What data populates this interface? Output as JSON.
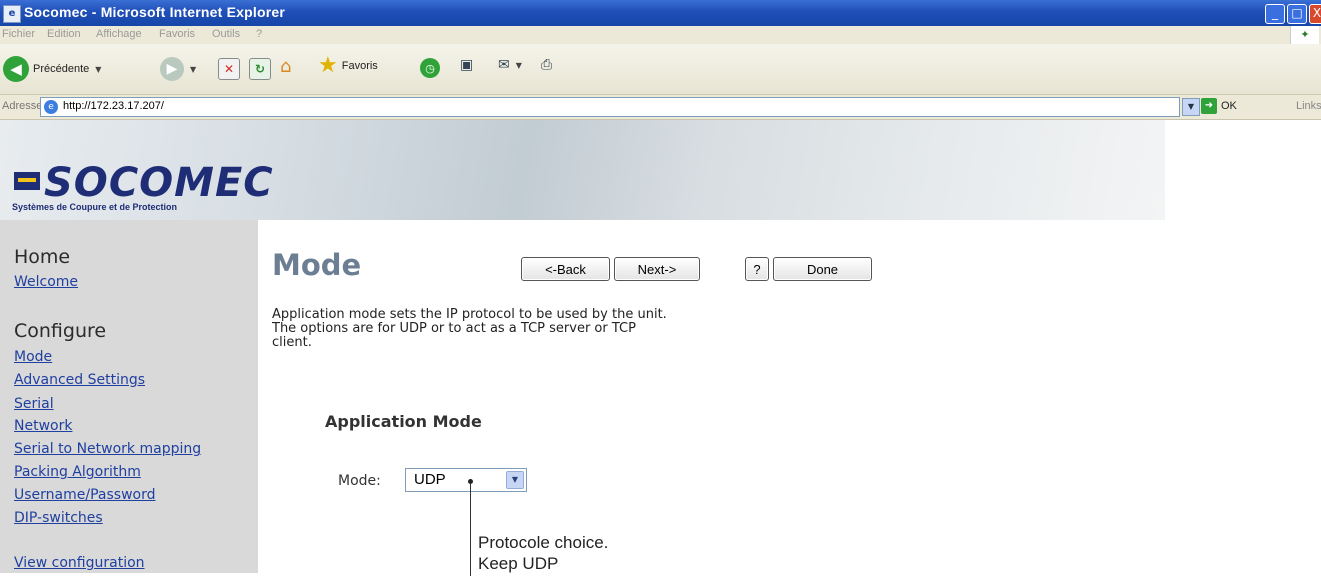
{
  "window": {
    "title": "Socomec - Microsoft Internet Explorer",
    "controls": {
      "minimize": "_",
      "maximize": "□",
      "close": "X"
    }
  },
  "menu": [
    "Fichier",
    "Edition",
    "Affichage",
    "Favoris",
    "Outils",
    "?"
  ],
  "toolbar": {
    "back_label": "Précédente",
    "favorites_label": "Favoris"
  },
  "address": {
    "label": "Adresse",
    "url": "http://172.23.17.207/",
    "go_label": "OK",
    "links_label": "Links"
  },
  "logo": {
    "name": "SOCOMEC",
    "tagline": "Systèmes de Coupure et de Protection"
  },
  "sidebar": {
    "home_heading": "Home",
    "home_links": [
      "Welcome"
    ],
    "configure_heading": "Configure",
    "configure_links": [
      "Mode",
      "Advanced Settings",
      "Serial",
      "Network",
      "Serial to Network mapping",
      "Packing Algorithm",
      "Username/Password",
      "DIP-switches"
    ],
    "view_link": "View configuration"
  },
  "main": {
    "title": "Mode",
    "buttons": {
      "back": "<-Back",
      "next": "Next->",
      "help": "?",
      "done": "Done"
    },
    "description": [
      "Application mode sets the IP protocol to be used by the unit.",
      "The options are for UDP or to act as a TCP server or TCP",
      "client."
    ],
    "section_heading": "Application Mode",
    "mode_label": "Mode:",
    "mode_value": "UDP"
  },
  "annotation": {
    "line1": "Protocole choice.",
    "line2": "Keep UDP"
  },
  "colors": {
    "titlebar": "#1f4fb8",
    "sidebar": "#d9d9d9",
    "link": "#2040a0",
    "page_title": "#6c7e93",
    "logo": "#1e2d75"
  }
}
